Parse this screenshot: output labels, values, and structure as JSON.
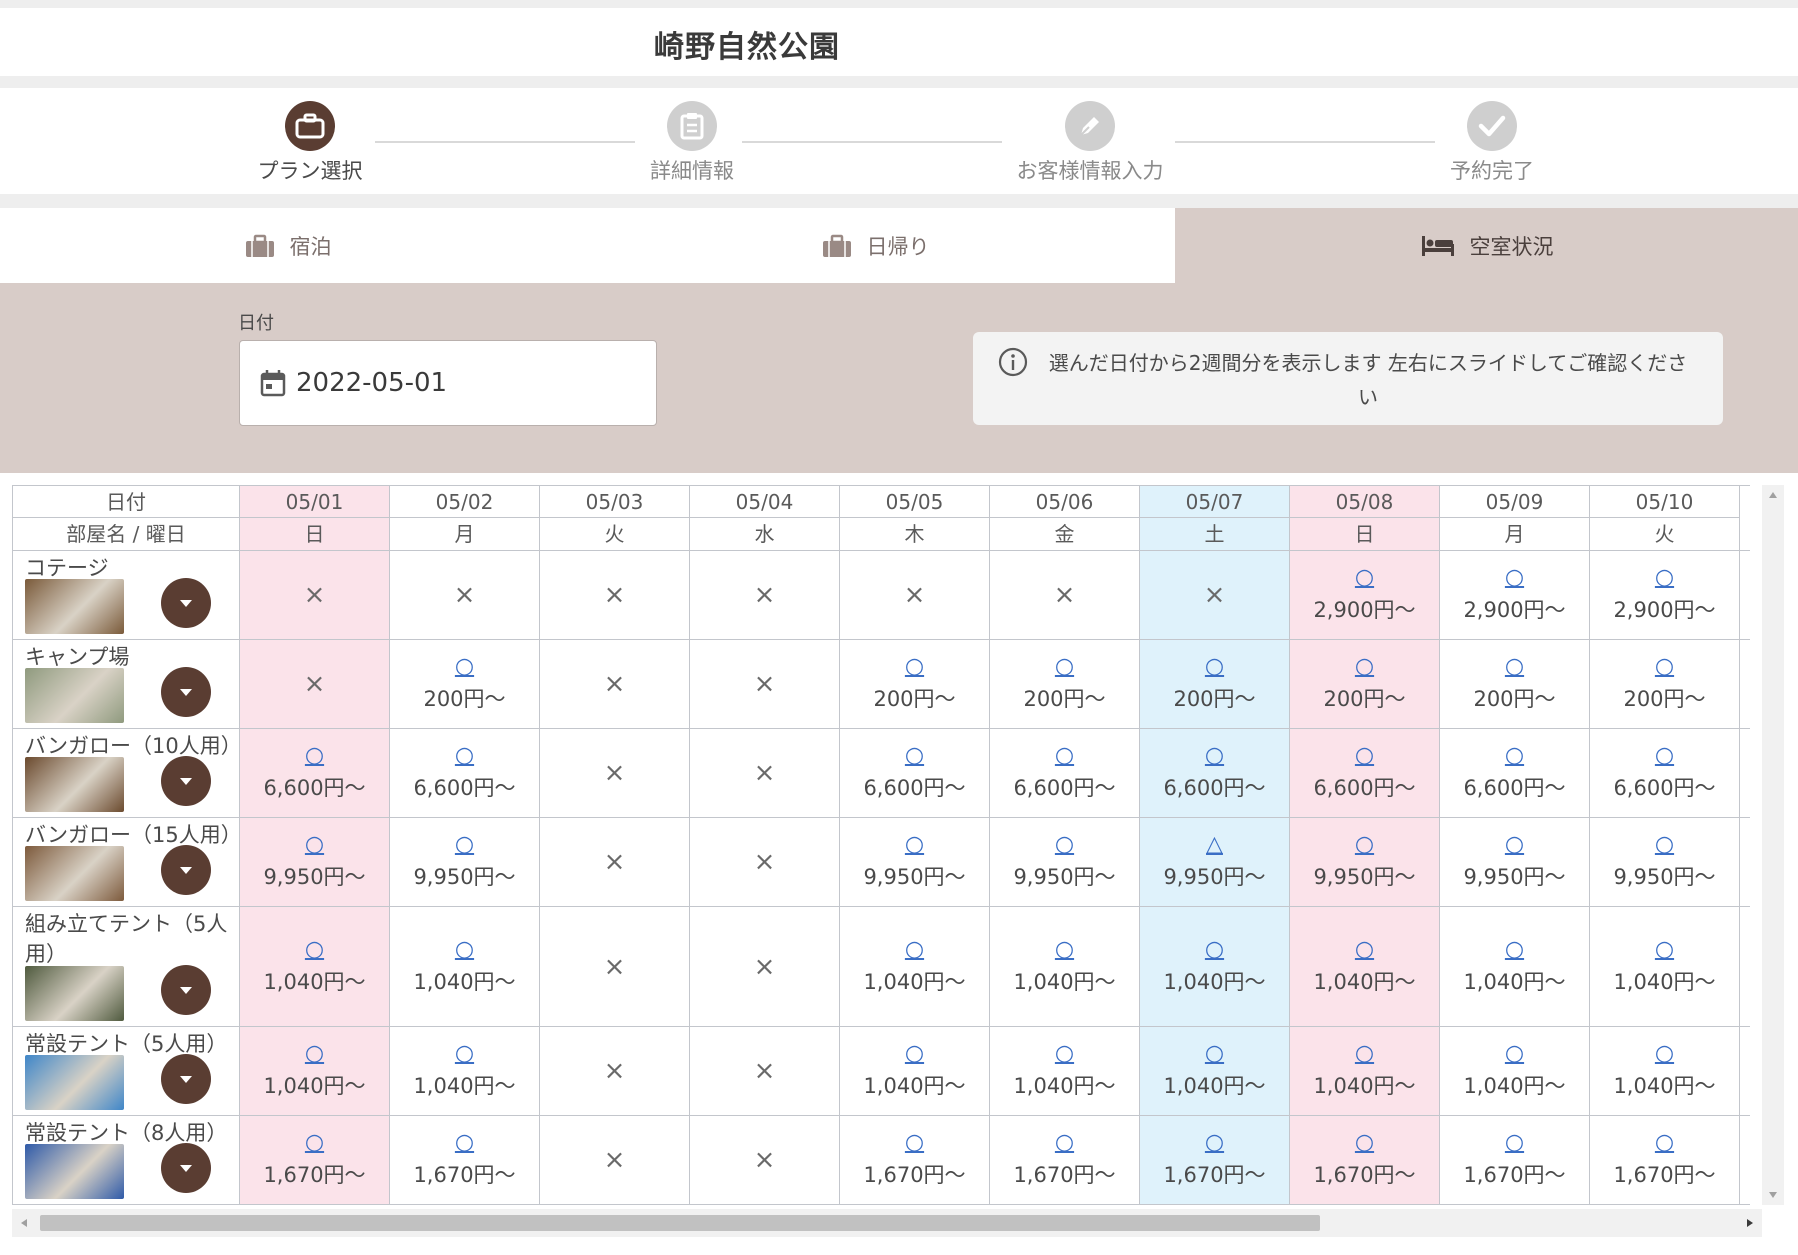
{
  "header": {
    "title": "崎野自然公園"
  },
  "steps": [
    {
      "label": "プラン選択",
      "icon": "briefcase-icon",
      "active": true
    },
    {
      "label": "詳細情報",
      "icon": "clipboard-icon",
      "active": false
    },
    {
      "label": "お客様情報入力",
      "icon": "pen-icon",
      "active": false
    },
    {
      "label": "予約完了",
      "icon": "check-icon",
      "active": false
    }
  ],
  "tabs": [
    {
      "label": "宿泊",
      "icon": "luggage-icon"
    },
    {
      "label": "日帰り",
      "icon": "luggage-icon"
    },
    {
      "label": "空室状況",
      "icon": "bed-icon",
      "active": true
    }
  ],
  "filter": {
    "date_label": "日付",
    "date_value": "2022-05-01",
    "info_text": "選んだ日付から2週間分を表示します 左右にスライドしてご確認ください"
  },
  "table": {
    "header_date_label": "日付",
    "header_room_label": "部屋名 / 曜日",
    "dates": [
      {
        "date": "05/01",
        "dow": "日",
        "kind": "sun"
      },
      {
        "date": "05/02",
        "dow": "月",
        "kind": ""
      },
      {
        "date": "05/03",
        "dow": "火",
        "kind": ""
      },
      {
        "date": "05/04",
        "dow": "水",
        "kind": ""
      },
      {
        "date": "05/05",
        "dow": "木",
        "kind": ""
      },
      {
        "date": "05/06",
        "dow": "金",
        "kind": ""
      },
      {
        "date": "05/07",
        "dow": "土",
        "kind": "sat"
      },
      {
        "date": "05/08",
        "dow": "日",
        "kind": "sun"
      },
      {
        "date": "05/09",
        "dow": "月",
        "kind": ""
      },
      {
        "date": "05/10",
        "dow": "火",
        "kind": ""
      }
    ],
    "rooms": [
      {
        "name": "コテージ",
        "thumb_color": "#7a5a3a",
        "cells": [
          [
            "×",
            ""
          ],
          [
            "×",
            ""
          ],
          [
            "×",
            ""
          ],
          [
            "×",
            ""
          ],
          [
            "×",
            ""
          ],
          [
            "×",
            ""
          ],
          [
            "×",
            ""
          ],
          [
            "○",
            "2,900円～"
          ],
          [
            "○",
            "2,900円～"
          ],
          [
            "○",
            "2,900円～"
          ]
        ]
      },
      {
        "name": "キャンプ場",
        "thumb_color": "#8f9a7e",
        "cells": [
          [
            "×",
            ""
          ],
          [
            "○",
            "200円～"
          ],
          [
            "×",
            ""
          ],
          [
            "×",
            ""
          ],
          [
            "○",
            "200円～"
          ],
          [
            "○",
            "200円～"
          ],
          [
            "○",
            "200円～"
          ],
          [
            "○",
            "200円～"
          ],
          [
            "○",
            "200円～"
          ],
          [
            "○",
            "200円～"
          ]
        ]
      },
      {
        "name": "バンガロー（10人用）",
        "thumb_color": "#6b4a2e",
        "cells": [
          [
            "○",
            "6,600円～"
          ],
          [
            "○",
            "6,600円～"
          ],
          [
            "×",
            ""
          ],
          [
            "×",
            ""
          ],
          [
            "○",
            "6,600円～"
          ],
          [
            "○",
            "6,600円～"
          ],
          [
            "○",
            "6,600円～"
          ],
          [
            "○",
            "6,600円～"
          ],
          [
            "○",
            "6,600円～"
          ],
          [
            "○",
            "6,600円～"
          ]
        ]
      },
      {
        "name": "バンガロー（15人用）",
        "thumb_color": "#7d5a3c",
        "cells": [
          [
            "○",
            "9,950円～"
          ],
          [
            "○",
            "9,950円～"
          ],
          [
            "×",
            ""
          ],
          [
            "×",
            ""
          ],
          [
            "○",
            "9,950円～"
          ],
          [
            "○",
            "9,950円～"
          ],
          [
            "△",
            "9,950円～"
          ],
          [
            "○",
            "9,950円～"
          ],
          [
            "○",
            "9,950円～"
          ],
          [
            "○",
            "9,950円～"
          ]
        ]
      },
      {
        "name": "組み立てテント（5人用）",
        "thumb_color": "#4f5a3e",
        "cells": [
          [
            "○",
            "1,040円～"
          ],
          [
            "○",
            "1,040円～"
          ],
          [
            "×",
            ""
          ],
          [
            "×",
            ""
          ],
          [
            "○",
            "1,040円～"
          ],
          [
            "○",
            "1,040円～"
          ],
          [
            "○",
            "1,040円～"
          ],
          [
            "○",
            "1,040円～"
          ],
          [
            "○",
            "1,040円～"
          ],
          [
            "○",
            "1,040円～"
          ]
        ]
      },
      {
        "name": "常設テント（5人用）",
        "thumb_color": "#3f86c8",
        "cells": [
          [
            "○",
            "1,040円～"
          ],
          [
            "○",
            "1,040円～"
          ],
          [
            "×",
            ""
          ],
          [
            "×",
            ""
          ],
          [
            "○",
            "1,040円～"
          ],
          [
            "○",
            "1,040円～"
          ],
          [
            "○",
            "1,040円～"
          ],
          [
            "○",
            "1,040円～"
          ],
          [
            "○",
            "1,040円～"
          ],
          [
            "○",
            "1,040円～"
          ]
        ]
      },
      {
        "name": "常設テント（8人用）",
        "thumb_color": "#2f5aa8",
        "cells": [
          [
            "○",
            "1,670円～"
          ],
          [
            "○",
            "1,670円～"
          ],
          [
            "×",
            ""
          ],
          [
            "×",
            ""
          ],
          [
            "○",
            "1,670円～"
          ],
          [
            "○",
            "1,670円～"
          ],
          [
            "○",
            "1,670円～"
          ],
          [
            "○",
            "1,670円～"
          ],
          [
            "○",
            "1,670円～"
          ],
          [
            "○",
            "1,670円～"
          ]
        ]
      }
    ]
  }
}
